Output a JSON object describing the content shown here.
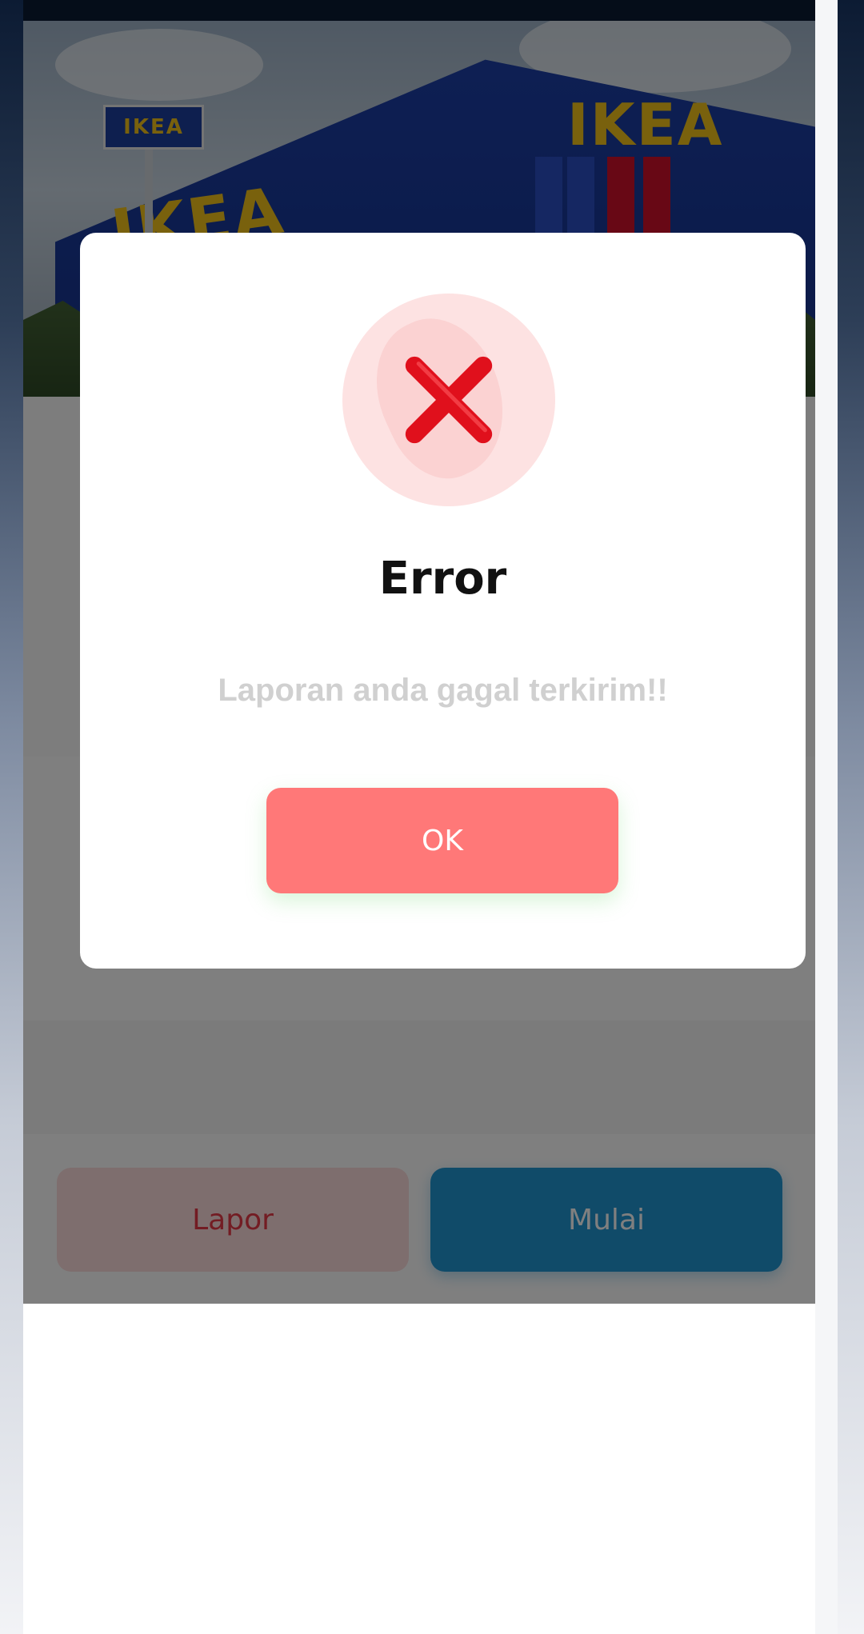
{
  "hero": {
    "sign_main": "IKEA",
    "sign_left": "IKEA",
    "pole_sign": "IKEA"
  },
  "actions": {
    "report_label": "Lapor",
    "start_label": "Mulai"
  },
  "dialog": {
    "icon": "error-x-icon",
    "title": "Error",
    "message": "Laporan anda gagal terkirim!!",
    "ok_label": "OK"
  },
  "colors": {
    "overlay": "rgba(0,0,0,0.5)",
    "ok_button": "#ff7878",
    "error_circle": "#fde2e2",
    "error_x": "#e0101c",
    "start_button": "#2196d3",
    "report_button": "#fcdcdc"
  }
}
